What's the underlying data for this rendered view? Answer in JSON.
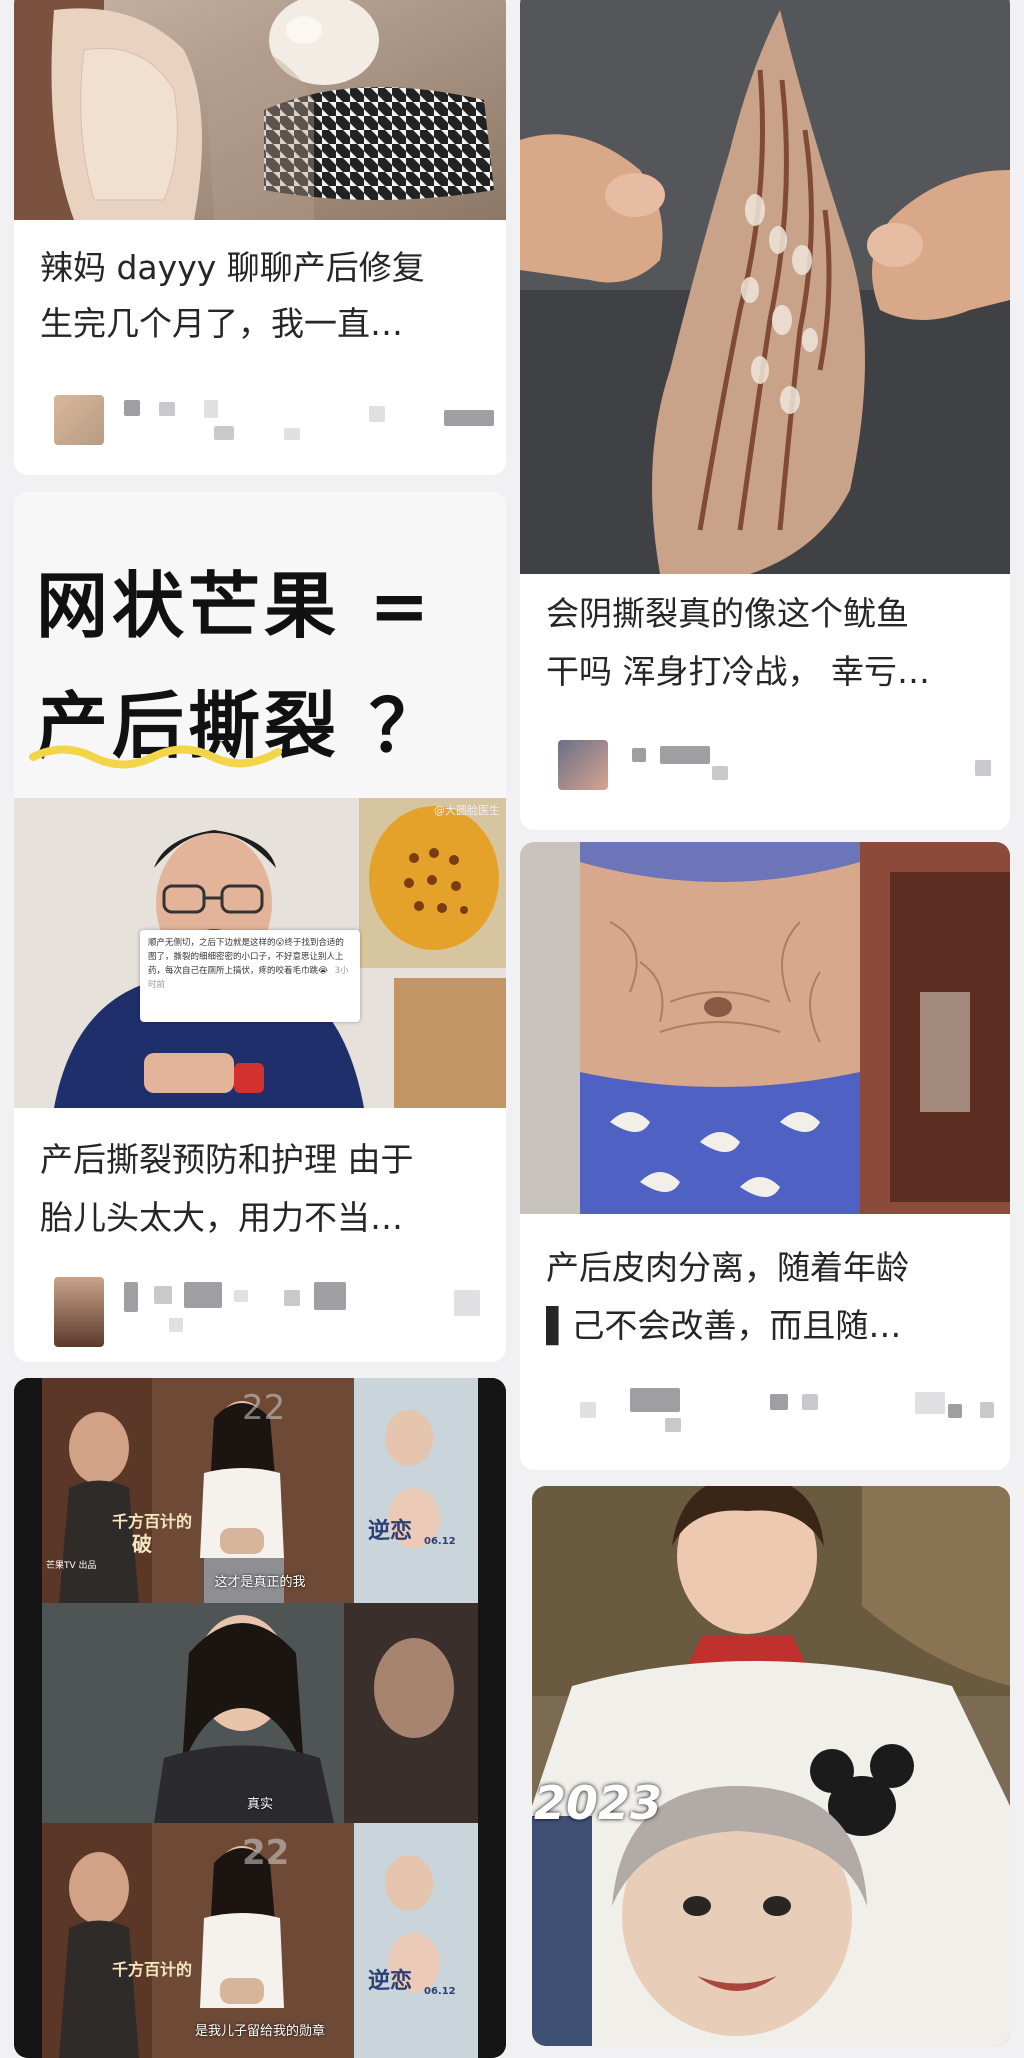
{
  "feed": {
    "cards": [
      {
        "title_line1": "辣妈 dayyy 聊聊产后修复",
        "title_line2": "生完几个月了，我一直…"
      },
      {
        "title_line1": "会阴撕裂真的像这个鱿鱼",
        "title_line2": "干吗 浑身打冷战， 幸亏…"
      },
      {
        "cover_headline_line1": "网状芒果 =",
        "cover_headline_line2": "产后撕裂 ？",
        "watermark": "@大圆脸医生",
        "comment_text": "顺产无侧切，之后下边就是这样的😮终于找到合适的图了，撕裂的细细密密的小口子，不好意思让别人上药，每次自己在厕所上搞伏，疼的咬着毛巾跳😭",
        "comment_time": "3小时前",
        "title_line1": "产后撕裂预防和护理 由于",
        "title_line2": "胎儿头太大，用力不当…"
      },
      {
        "title_line1": "产后皮肉分离，随着年龄",
        "title_line2": "▌己不会改善，而且随…"
      },
      {
        "poster_number": "22",
        "poster_left": "千方百计的",
        "poster_left2": "破",
        "poster_right": "逆恋",
        "poster_date": "06.12",
        "channel_logo": "芒果TV 出品",
        "subtitle1": "这才是真正的我",
        "subtitle2": "真实",
        "subtitle3": "是我儿子留给我的勋章"
      },
      {
        "year_label": "2023"
      }
    ]
  },
  "colors": {
    "page_bg": "#f1f1f3",
    "card_bg": "#ffffff",
    "title_text": "#262626",
    "cover_yellow": "#f3d54a"
  }
}
